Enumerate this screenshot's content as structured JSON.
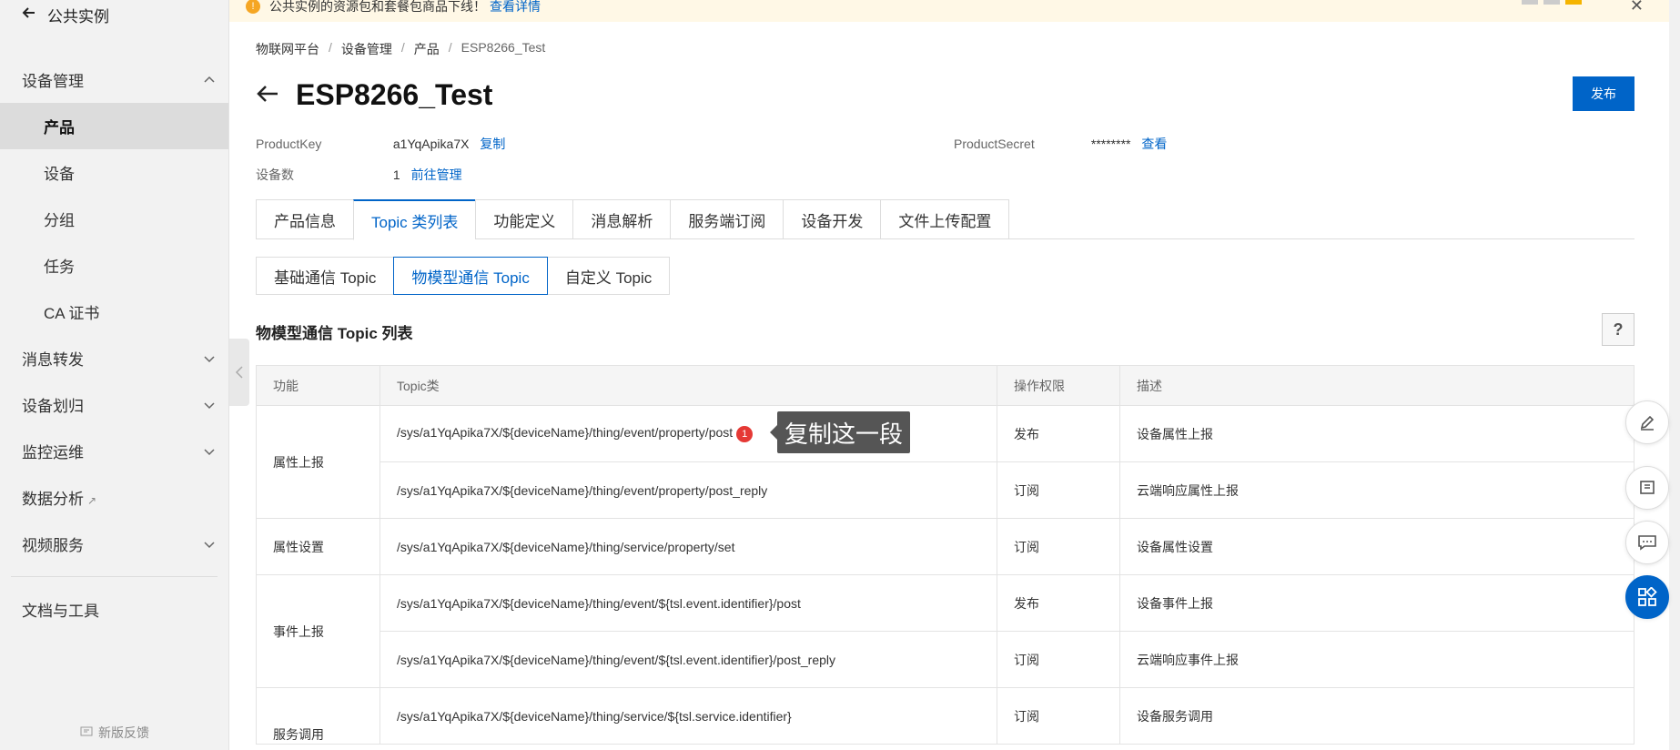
{
  "sidebar": {
    "back_label": "公共实例",
    "groups": [
      {
        "label": "设备管理"
      },
      {
        "label": "消息转发"
      },
      {
        "label": "设备划归"
      },
      {
        "label": "监控运维"
      },
      {
        "label": "数据分析"
      },
      {
        "label": "视频服务"
      },
      {
        "label": "文档与工具"
      }
    ],
    "items": [
      {
        "label": "产品"
      },
      {
        "label": "设备"
      },
      {
        "label": "分组"
      },
      {
        "label": "任务"
      },
      {
        "label": "CA 证书"
      }
    ],
    "footer": "新版反馈"
  },
  "notice": {
    "text": "公共实例的资源包和套餐包商品下线！",
    "link": "查看详情"
  },
  "breadcrumb": [
    "物联网平台",
    "设备管理",
    "产品",
    "ESP8266_Test"
  ],
  "page": {
    "title": "ESP8266_Test",
    "publish": "发布"
  },
  "meta": {
    "product_key_label": "ProductKey",
    "product_key": "a1YqApika7X",
    "copy": "复制",
    "product_secret_label": "ProductSecret",
    "product_secret": "********",
    "view": "查看",
    "device_count_label": "设备数",
    "device_count": "1",
    "manage": "前往管理"
  },
  "tabs": [
    "产品信息",
    "Topic 类列表",
    "功能定义",
    "消息解析",
    "服务端订阅",
    "设备开发",
    "文件上传配置"
  ],
  "subtabs": [
    "基础通信 Topic",
    "物模型通信 Topic",
    "自定义 Topic"
  ],
  "section_title": "物模型通信 Topic 列表",
  "table": {
    "headers": [
      "功能",
      "Topic类",
      "操作权限",
      "描述"
    ],
    "rows": [
      {
        "feature": "属性上报",
        "topic": "/sys/a1YqApika7X/${deviceName}/thing/event/property/post",
        "perm": "发布",
        "desc": "设备属性上报"
      },
      {
        "topic": "/sys/a1YqApika7X/${deviceName}/thing/event/property/post_reply",
        "perm": "订阅",
        "desc": "云端响应属性上报"
      },
      {
        "feature": "属性设置",
        "topic": "/sys/a1YqApika7X/${deviceName}/thing/service/property/set",
        "perm": "订阅",
        "desc": "设备属性设置"
      },
      {
        "feature": "事件上报",
        "topic": "/sys/a1YqApika7X/${deviceName}/thing/event/${tsl.event.identifier}/post",
        "perm": "发布",
        "desc": "设备事件上报"
      },
      {
        "topic": "/sys/a1YqApika7X/${deviceName}/thing/event/${tsl.event.identifier}/post_reply",
        "perm": "订阅",
        "desc": "云端响应事件上报"
      },
      {
        "feature": "服务调用",
        "topic": "/sys/a1YqApika7X/${deviceName}/thing/service/${tsl.service.identifier}",
        "perm": "订阅",
        "desc": "设备服务调用"
      }
    ]
  },
  "annotation": {
    "badge": "1",
    "tooltip": "复制这一段"
  }
}
